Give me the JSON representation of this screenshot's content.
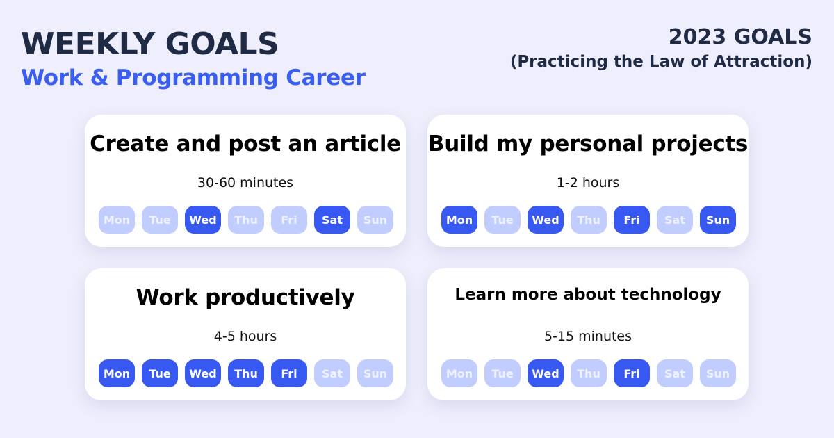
{
  "header": {
    "title": "WEEKLY GOALS",
    "subtitle": "Work & Programming Career",
    "year_title": "2023 GOALS",
    "year_subtitle": "(Practicing the Law of Attraction)"
  },
  "colors": {
    "background": "#EEEEFC",
    "accent": "#3A5EF0",
    "day_active": "#3858F2",
    "day_inactive": "#C2CDFF",
    "heading": "#1F2A44"
  },
  "goals": [
    {
      "title": "Create and post an article",
      "duration": "30-60 minutes",
      "days": [
        {
          "label": "Mon",
          "active": false
        },
        {
          "label": "Tue",
          "active": false
        },
        {
          "label": "Wed",
          "active": true
        },
        {
          "label": "Thu",
          "active": false
        },
        {
          "label": "Fri",
          "active": false
        },
        {
          "label": "Sat",
          "active": true
        },
        {
          "label": "Sun",
          "active": false
        }
      ]
    },
    {
      "title": "Build my personal projects",
      "duration": "1-2 hours",
      "days": [
        {
          "label": "Mon",
          "active": true
        },
        {
          "label": "Tue",
          "active": false
        },
        {
          "label": "Wed",
          "active": true
        },
        {
          "label": "Thu",
          "active": false
        },
        {
          "label": "Fri",
          "active": true
        },
        {
          "label": "Sat",
          "active": false
        },
        {
          "label": "Sun",
          "active": true
        }
      ]
    },
    {
      "title": "Work productively",
      "duration": "4-5 hours",
      "days": [
        {
          "label": "Mon",
          "active": true
        },
        {
          "label": "Tue",
          "active": true
        },
        {
          "label": "Wed",
          "active": true
        },
        {
          "label": "Thu",
          "active": true
        },
        {
          "label": "Fri",
          "active": true
        },
        {
          "label": "Sat",
          "active": false
        },
        {
          "label": "Sun",
          "active": false
        }
      ]
    },
    {
      "title": "Learn more about technology",
      "duration": "5-15 minutes",
      "days": [
        {
          "label": "Mon",
          "active": false
        },
        {
          "label": "Tue",
          "active": false
        },
        {
          "label": "Wed",
          "active": true
        },
        {
          "label": "Thu",
          "active": false
        },
        {
          "label": "Fri",
          "active": true
        },
        {
          "label": "Sat",
          "active": false
        },
        {
          "label": "Sun",
          "active": false
        }
      ]
    }
  ]
}
